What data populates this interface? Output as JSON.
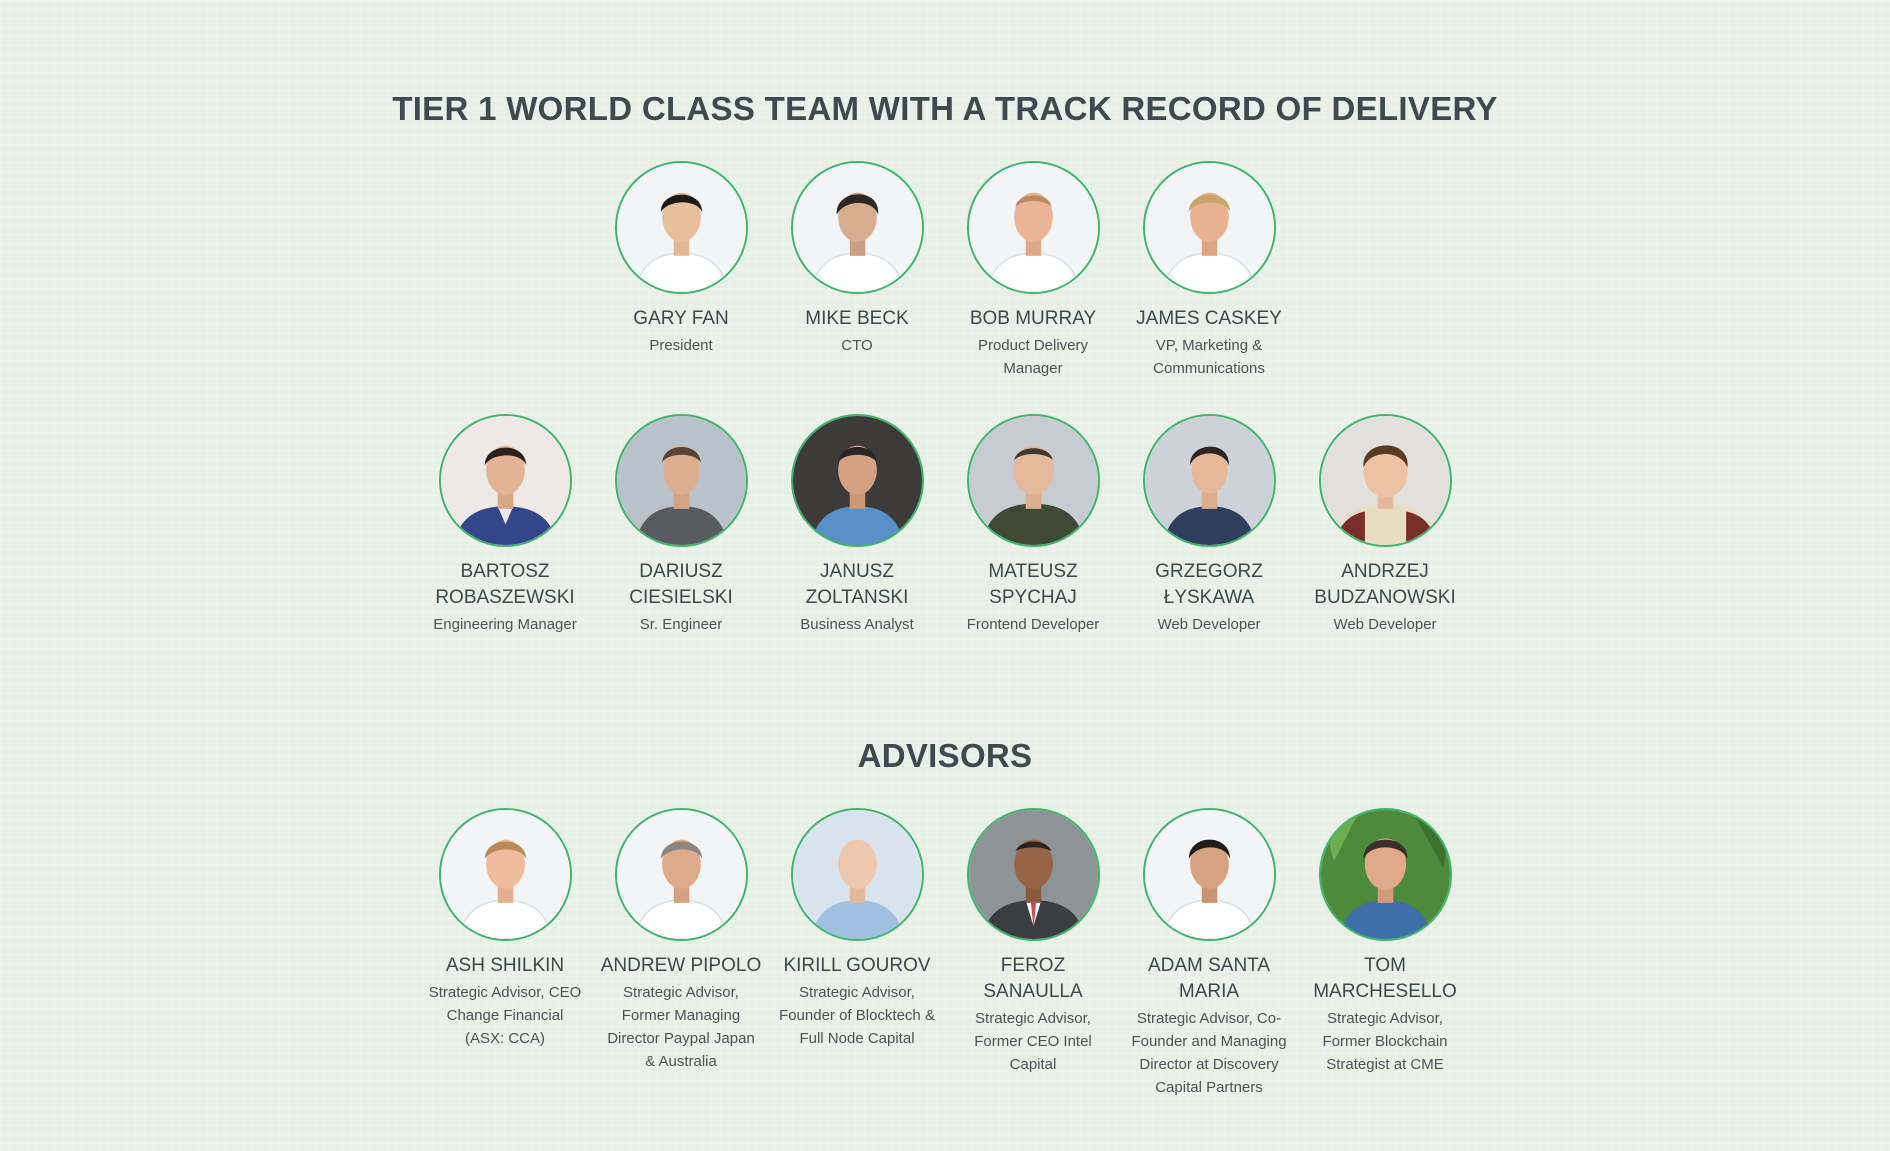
{
  "team": {
    "title": "TIER 1 WORLD CLASS TEAM WITH A TRACK RECORD OF DELIVERY",
    "leaders": [
      {
        "name": "GARY FAN",
        "role": "President",
        "photo": "portrait-white-bg"
      },
      {
        "name": "MIKE BECK",
        "role": "CTO",
        "photo": "portrait-white-bg"
      },
      {
        "name": "BOB MURRAY",
        "role": "Product Delivery Manager",
        "photo": "portrait-white-bg"
      },
      {
        "name": "JAMES CASKEY",
        "role": "VP, Marketing & Communications",
        "photo": "portrait-white-bg"
      }
    ],
    "engineers": [
      {
        "name": "BARTOSZ ROBASZEWSKI",
        "role": "Engineering Manager",
        "photo": "portrait-suit"
      },
      {
        "name": "DARIUSZ CIESIELSKI",
        "role": "Sr. Engineer",
        "photo": "portrait-tshirt"
      },
      {
        "name": "JANUSZ ZOLTANSKI",
        "role": "Business Analyst",
        "photo": "portrait-dark-bg"
      },
      {
        "name": "MATEUSZ SPYCHAJ",
        "role": "Frontend Developer",
        "photo": "portrait-green-shirt"
      },
      {
        "name": "GRZEGORZ ŁYSKAWA",
        "role": "Web Developer",
        "photo": "portrait-plaid"
      },
      {
        "name": "ANDRZEJ BUDZANOWSKI",
        "role": "Web Developer",
        "photo": "portrait-beige"
      }
    ]
  },
  "advisors": {
    "title": "ADVISORS",
    "members": [
      {
        "name": "ASH SHILKIN",
        "role": "Strategic Advisor, CEO Change Financial (ASX: CCA)",
        "photo": "portrait-white-bg"
      },
      {
        "name": "ANDREW PIPOLO",
        "role": "Strategic Advisor, Former Managing Director Paypal Japan & Australia",
        "photo": "portrait-white-bg"
      },
      {
        "name": "KIRILL GOUROV",
        "role": "Strategic Advisor, Founder of Blocktech & Full Node Capital",
        "photo": "portrait-blue-bg"
      },
      {
        "name": "FEROZ SANAULLA",
        "role": "Strategic Advisor, Former CEO Intel Capital",
        "photo": "portrait-gray-suit"
      },
      {
        "name": "ADAM SANTA MARIA",
        "role": "Strategic Advisor, Co-Founder and Managing Director at Discovery Capital Partners",
        "photo": "portrait-white-bg"
      },
      {
        "name": "TOM MARCHESELLO",
        "role": "Strategic Advisor, Former Blockchain Strategist at CME",
        "photo": "portrait-green-bg"
      }
    ]
  },
  "colors": {
    "accent": "#3fb46a",
    "background": "#e8efe6",
    "text": "#3b494e"
  }
}
